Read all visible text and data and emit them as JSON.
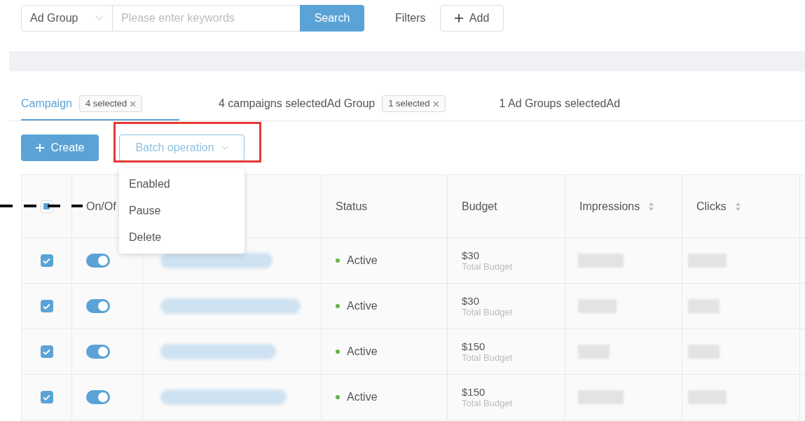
{
  "search_bar": {
    "scope": "Ad Group",
    "placeholder": "Please enter keywords",
    "button": "Search",
    "filters_label": "Filters",
    "add_button": "Add"
  },
  "tabs": [
    {
      "label": "Campaign",
      "badge": "4 selected",
      "selected": true
    },
    {
      "label": "4 campaigns selectedAd Group",
      "badge": "1 selected",
      "selected": false
    },
    {
      "label": "1 Ad Groups selectedAd",
      "selected": false
    }
  ],
  "toolbar": {
    "create_button": "Create",
    "batch_button": "Batch operation",
    "highlighted": true
  },
  "batch_menu": {
    "open": true,
    "items": [
      "Enabled",
      "Pause",
      "Delete"
    ]
  },
  "table": {
    "header_checkbox_indeterminate": true,
    "columns": [
      {
        "label": "On/Of"
      },
      {
        "label": "Status",
        "sortable": false
      },
      {
        "label": "Budget",
        "sortable": false
      },
      {
        "label": "Impressions",
        "sortable": true
      },
      {
        "label": "Clicks",
        "sortable": true
      }
    ],
    "rows": [
      {
        "checked": true,
        "on": true,
        "status": "Active",
        "color": "#67b346",
        "budget": "$30",
        "budget_label": "Total Budget"
      },
      {
        "checked": true,
        "on": true,
        "status": "Active",
        "color": "#67b346",
        "budget": "$30",
        "budget_label": "Total Budget"
      },
      {
        "checked": true,
        "on": true,
        "status": "Active",
        "color": "#67b346",
        "budget": "$150",
        "budget_label": "Total Budget"
      },
      {
        "checked": true,
        "on": true,
        "status": "Active",
        "color": "#67b346",
        "budget": "$150",
        "budget_label": "Total Budget"
      }
    ]
  },
  "annotation": {
    "dashed_line": true
  }
}
